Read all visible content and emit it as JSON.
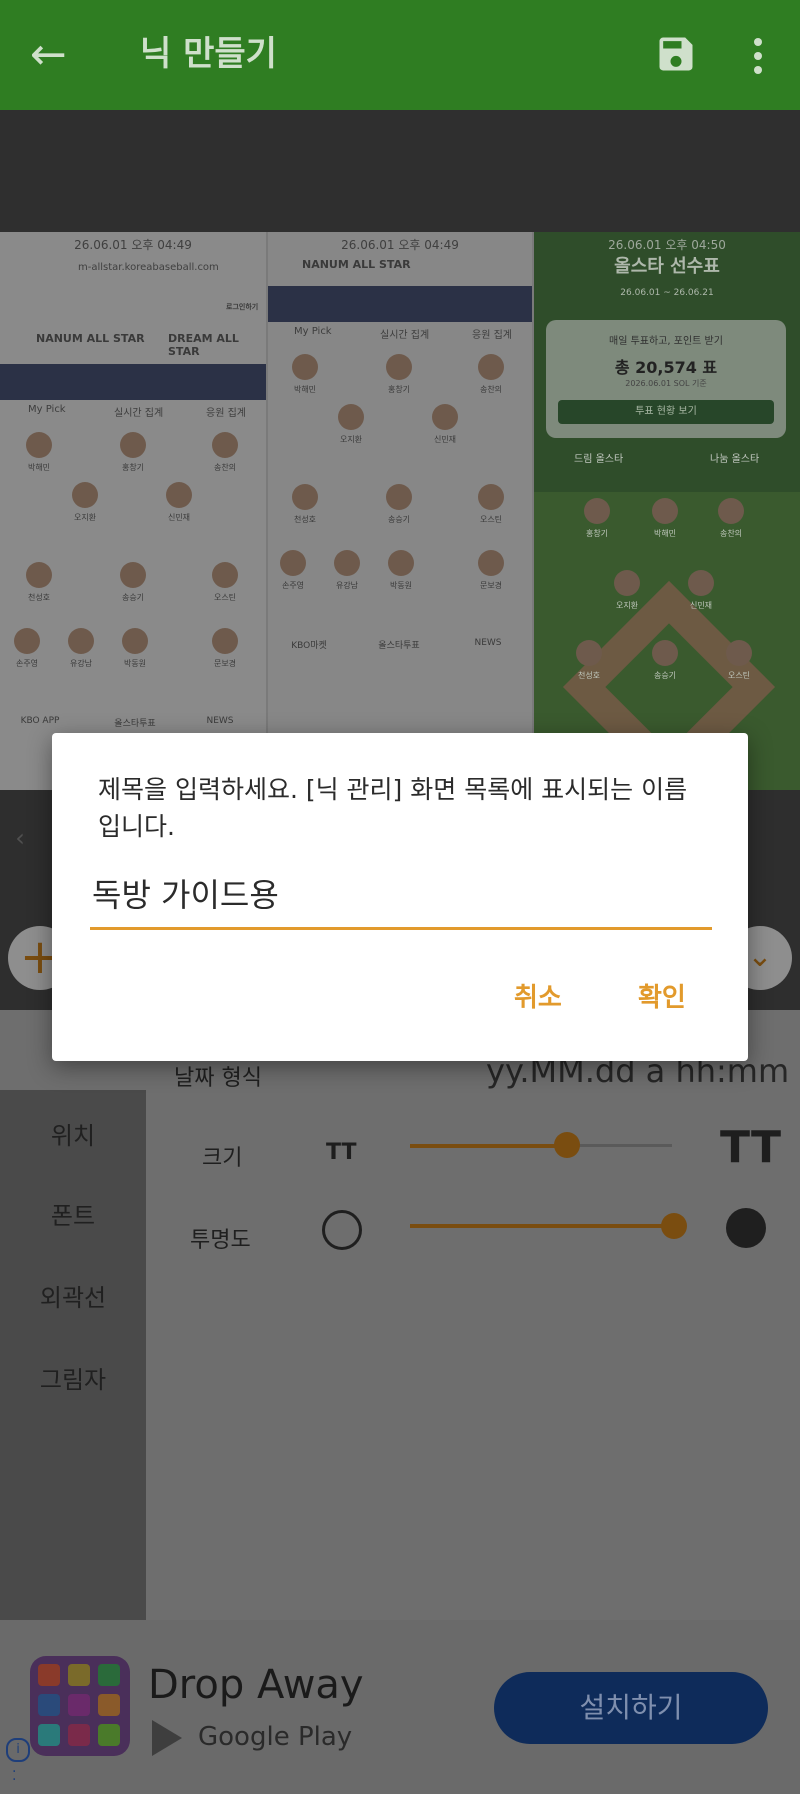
{
  "appbar": {
    "title": "닉 만들기",
    "back_icon": "←"
  },
  "preview": {
    "shot1": {
      "time": "26.06.01 오후 04:49",
      "url": "m-allstar.koreabaseball.com",
      "logo": "NANUM ALL STAR",
      "logo2": "DREAM ALL STAR",
      "login": "로그인하기",
      "tab1": "My Pick",
      "tab2": "실시간 집계",
      "tab3": "응원 집계",
      "players": [
        "박해민",
        "홍창기",
        "송찬의",
        "오지환",
        "신민재",
        "천성호",
        "송승기",
        "오스틴",
        "손주영",
        "유강남",
        "박동원",
        "문보경"
      ],
      "nav1": "KBO APP",
      "nav2": "올스타투표",
      "nav3": "NEWS"
    },
    "shot2": {
      "time": "26.06.01 오후 04:49",
      "logo": "NANUM ALL STAR",
      "tab1": "My Pick",
      "tab2": "실시간 집계",
      "tab3": "응원 집계",
      "players": [
        "박해민",
        "홍창기",
        "송찬의",
        "오지환",
        "신민재",
        "천성호",
        "송승기",
        "오스틴",
        "손주영",
        "유강남",
        "박동원",
        "문보경"
      ],
      "nav1": "KBO마켓",
      "nav2": "올스타투표",
      "nav3": "NEWS"
    },
    "shot3": {
      "time": "26.06.01 오후 04:50",
      "header": "올스타 선수표",
      "range": "26.06.01 ~ 26.06.21",
      "vote_a": "매일 투표하고, 포인트 받기",
      "vote_b": "총 20,574 표",
      "vote_c": "2026.06.01 SOL 기준",
      "vote_btn": "투표 현황 보기",
      "tab1": "드림 올스타",
      "tab2": "나눔 올스타",
      "players": [
        "홍창기",
        "박해민",
        "송찬의",
        "오지환",
        "신민재",
        "천성호",
        "송승기",
        "오스틴"
      ]
    }
  },
  "dialog": {
    "message": "제목을 입력하세요. [닉 관리] 화면 목록에 표시되는 이름입니다.",
    "input_value": "독방 가이드용",
    "cancel": "취소",
    "confirm": "확인"
  },
  "settings": {
    "date_label": "날짜 형식",
    "date_format": "yy.MM.dd  a hh:mm",
    "sidebar": [
      "위치",
      "폰트",
      "외곽선",
      "그림자"
    ],
    "size_label": "크기",
    "size_value": 0.6,
    "opacity_label": "투명도",
    "opacity_value": 1.0,
    "tt_icon": "TT"
  },
  "ad": {
    "title": "Drop Away",
    "store": "Google Play",
    "install": "설치하기",
    "info": "i"
  },
  "colors": {
    "accent": "#e29a2c",
    "appbar": "#2f7d22",
    "install": "#0e2b5a"
  }
}
